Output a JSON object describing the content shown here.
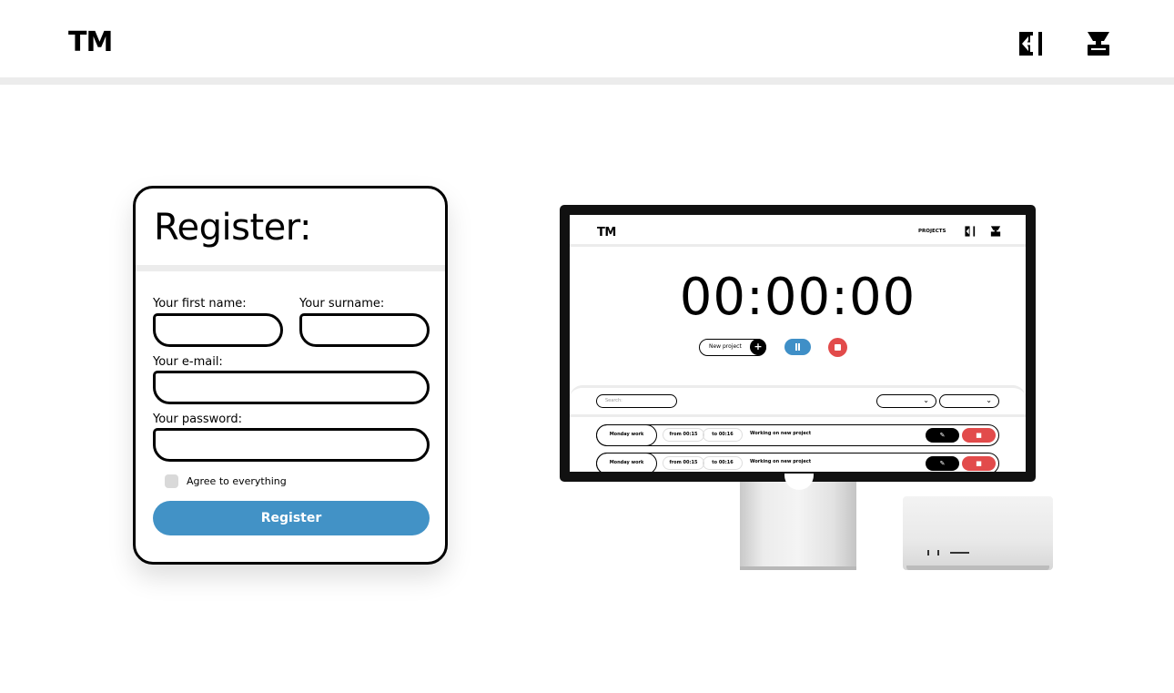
{
  "header": {
    "logo": "TM",
    "icons": [
      "logout-icon",
      "user-icon"
    ]
  },
  "register": {
    "title": "Register:",
    "first_name_label": "Your first name:",
    "surname_label": "Your surname:",
    "email_label": "Your e-mail:",
    "password_label": "Your password:",
    "first_name_value": "",
    "surname_value": "",
    "email_value": "",
    "password_value": "",
    "agree_label": "Agree to everything",
    "agree_checked": false,
    "submit_label": "Register"
  },
  "preview": {
    "logo": "TM",
    "nav_projects": "PROJECTS",
    "timer": "00:00:00",
    "new_project_label": "New project",
    "search_placeholder": "Search:",
    "rows": [
      {
        "name": "Monday work",
        "from": "from 00:15",
        "to": "to 00:16",
        "description": "Working on new project"
      },
      {
        "name": "Monday work",
        "from": "from 00:15",
        "to": "to 00:16",
        "description": "Working on new project"
      }
    ]
  },
  "colors": {
    "accent_blue": "#4292c6",
    "danger_red": "#e24b4b",
    "divider_gray": "#ececec"
  }
}
